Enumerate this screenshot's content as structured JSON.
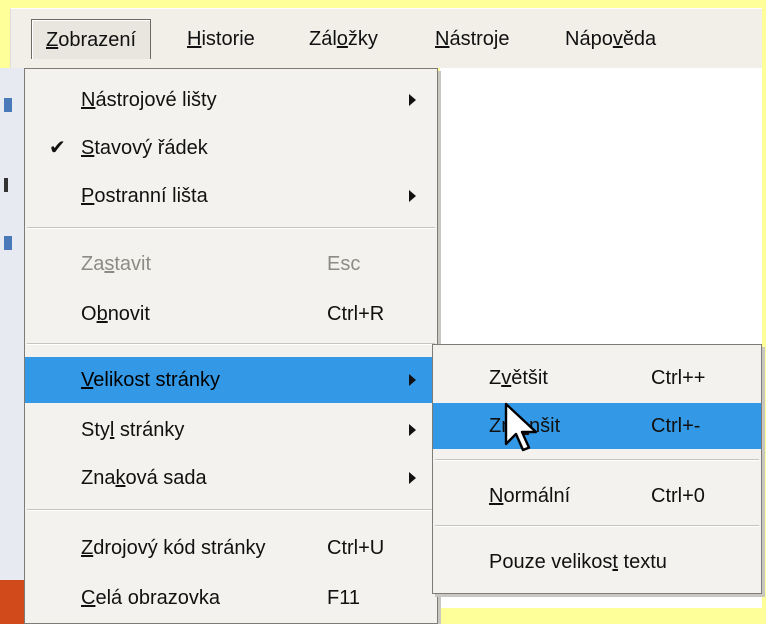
{
  "menubar": {
    "items": [
      {
        "pre": "",
        "acc": "Z",
        "post": "obrazení"
      },
      {
        "pre": "",
        "acc": "H",
        "post": "istorie"
      },
      {
        "pre": "Zál",
        "acc": "o",
        "post": "žky"
      },
      {
        "pre": "",
        "acc": "N",
        "post": "ástroje"
      },
      {
        "pre": "Nápo",
        "acc": "v",
        "post": "ěda"
      }
    ]
  },
  "menu": {
    "items": [
      {
        "pre": "",
        "acc": "N",
        "post": "ástrojové lišty",
        "shortcut": ""
      },
      {
        "pre": "",
        "acc": "S",
        "post": "tavový řádek",
        "shortcut": ""
      },
      {
        "pre": "",
        "acc": "P",
        "post": "ostranní lišta",
        "shortcut": ""
      },
      {
        "pre": "Za",
        "acc": "s",
        "post": "tavit",
        "shortcut": "Esc"
      },
      {
        "pre": "O",
        "acc": "b",
        "post": "novit",
        "shortcut": "Ctrl+R"
      },
      {
        "pre": "",
        "acc": "V",
        "post": "elikost stránky",
        "shortcut": ""
      },
      {
        "pre": "Sty",
        "acc": "l",
        "post": " stránky",
        "shortcut": ""
      },
      {
        "pre": "Zna",
        "acc": "k",
        "post": "ová sada",
        "shortcut": ""
      },
      {
        "pre": "",
        "acc": "Z",
        "post": "drojový kód stránky",
        "shortcut": "Ctrl+U"
      },
      {
        "pre": "",
        "acc": "C",
        "post": "elá obrazovka",
        "shortcut": "F11"
      }
    ],
    "check_glyph": "✔"
  },
  "submenu": {
    "items": [
      {
        "pre": "Z",
        "acc": "v",
        "post": "ětšit",
        "shortcut": "Ctrl++"
      },
      {
        "pre": "Zm",
        "acc": "e",
        "post": "nšit",
        "shortcut": "Ctrl+-"
      },
      {
        "pre": "",
        "acc": "N",
        "post": "ormální",
        "shortcut": "Ctrl+0"
      },
      {
        "pre": "Pouze velikos",
        "acc": "t",
        "post": " textu",
        "shortcut": ""
      }
    ]
  },
  "colors": {
    "highlight": "#3399e6",
    "frame": "#ffff99"
  },
  "icons": {
    "cursor": "arrow-pointer-icon",
    "check": "checkmark-icon",
    "submenu_arrow": "triangle-right-icon"
  }
}
